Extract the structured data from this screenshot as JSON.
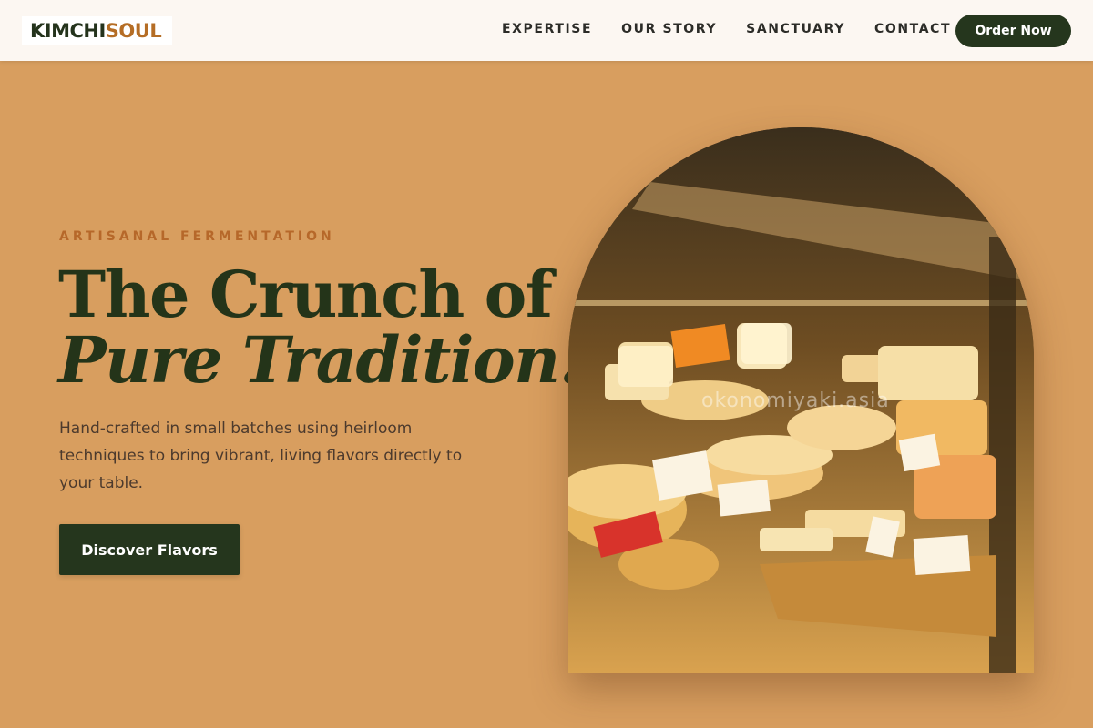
{
  "brand": {
    "name_part1": "KIMCHI",
    "name_part2": "SOUL"
  },
  "nav": {
    "links": [
      {
        "label": "EXPERTISE"
      },
      {
        "label": "OUR STORY"
      },
      {
        "label": "SANCTUARY"
      },
      {
        "label": "CONTACT"
      }
    ],
    "order_label": "Order Now"
  },
  "hero": {
    "eyebrow": "ARTISANAL FERMENTATION",
    "headline_line1": "The Crunch of",
    "headline_line2": "Pure Tradition.",
    "lede": "Hand-crafted in small batches using heirloom techniques to bring vibrant, living flavors directly to your table.",
    "cta_label": "Discover Flavors",
    "image_watermark": "okonomiyaki.asia"
  },
  "colors": {
    "page_background": "#d89e5f",
    "header_background": "#fcf7f2",
    "brand_dark_green": "#25361d",
    "brand_amber": "#b56d25",
    "eyebrow": "#b6682a",
    "body_text": "#4c3a2d"
  }
}
